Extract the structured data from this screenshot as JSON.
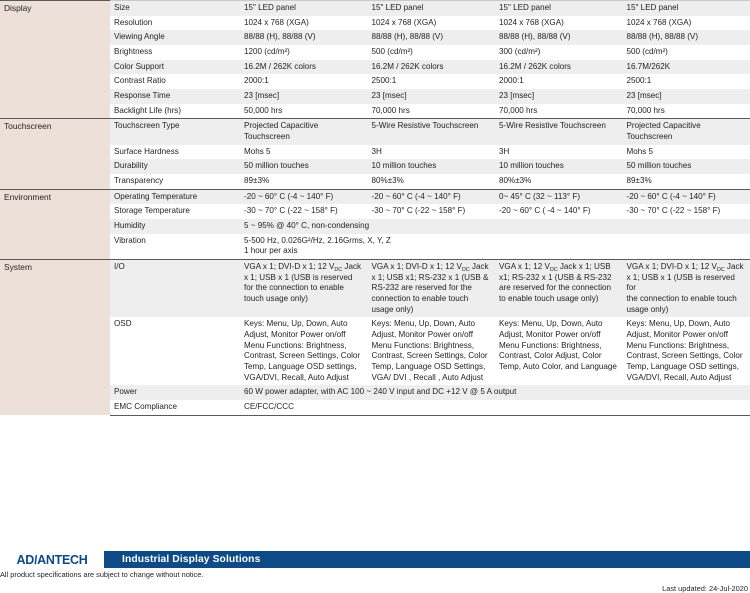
{
  "document": {
    "type": "product-specification-table",
    "columns_count": 4
  },
  "sections": [
    {
      "group": "Display",
      "rows": [
        {
          "name": "Size",
          "values": [
            "15\" LED panel",
            "15\" LED panel",
            "15\" LED panel",
            "15\" LED panel"
          ]
        },
        {
          "name": "Resolution",
          "values": [
            "1024 x 768 (XGA)",
            "1024 x 768 (XGA)",
            "1024 x 768 (XGA)",
            "1024 x 768 (XGA)"
          ]
        },
        {
          "name": "Viewing Angle",
          "values": [
            "88/88 (H), 88/88 (V)",
            "88/88 (H), 88/88 (V)",
            "88/88 (H), 88/88 (V)",
            "88/88 (H), 88/88 (V)"
          ]
        },
        {
          "name": "Brightness",
          "values": [
            "1200 (cd/m²)",
            "500 (cd/m²)",
            "300 (cd/m²)",
            "500 (cd/m²)"
          ]
        },
        {
          "name": "Color Support",
          "values": [
            "16.2M / 262K colors",
            "16.2M / 262K colors",
            "16.2M / 262K colors",
            "16.7M/262K"
          ]
        },
        {
          "name": "Contrast Ratio",
          "values": [
            "2000:1",
            "2500:1",
            "2000:1",
            "2500:1"
          ]
        },
        {
          "name": "Response Time",
          "values": [
            "23 [msec]",
            "23 [msec]",
            "23 [msec]",
            "23 [msec]"
          ]
        },
        {
          "name": "Backlight Life (hrs)",
          "values": [
            "50,000 hrs",
            "70,000 hrs",
            "70,000 hrs",
            "70,000 hrs"
          ]
        }
      ]
    },
    {
      "group": "Touchscreen",
      "rows": [
        {
          "name": "Touchscreen Type",
          "values": [
            "Projected Capacitive Touchscreen",
            "5-Wire Resistive Touchscreen",
            "5-Wire Resistive Touchscreen",
            "Projected Capacitive Touchscreen"
          ]
        },
        {
          "name": "Surface Hardness",
          "values": [
            "Mohs 5",
            "3H",
            "3H",
            "Mohs 5"
          ]
        },
        {
          "name": "Durability",
          "values": [
            "50 million touches",
            "10 million  touches",
            "10 million touches",
            "50 million touches"
          ]
        },
        {
          "name": "Transparency",
          "values": [
            "89±3%",
            "80%±3%",
            "80%±3%",
            "89±3%"
          ]
        }
      ]
    },
    {
      "group": "Environment",
      "rows": [
        {
          "name": "Operating Temperature",
          "values": [
            "-20 ~ 60° C (-4 ~ 140° F)",
            "-20 ~ 60° C (-4 ~ 140° F)",
            "0~ 45° C (32 ~ 113° F)",
            "-20 ~ 60° C (-4 ~ 140° F)"
          ]
        },
        {
          "name": "Storage Temperature",
          "values": [
            "-30 ~ 70° C (-22 ~ 158° F)",
            "-30 ~ 70° C (-22 ~ 158° F)",
            "-20 ~ 60° C ( -4 ~ 140° F)",
            "-30 ~ 70° C (-22 ~ 158° F)"
          ]
        },
        {
          "name": "Humidity",
          "span": true,
          "values": [
            "5 ~ 95% @ 40° C, non-condensing"
          ]
        },
        {
          "name": "Vibration",
          "span": true,
          "values": [
            "5-500 Hz, 0.026G²/Hz, 2.16Grms, X, Y, Z\n1 hour per axis"
          ]
        }
      ]
    },
    {
      "group": "System",
      "rows": [
        {
          "name": "I/O",
          "values": [
            "VGA x 1; DVI-D x 1; 12 V|DC| Jack x 1; USB x 1 (USB is reserved for the connection to enable touch usage only)",
            "VGA x 1; DVI-D x 1; 12 V|DC| Jack x 1; USB x1; RS-232 x 1 (USB & RS-232 are reserved for the connection to enable touch usage only)",
            "VGA x 1; 12 V|DC|  Jack x 1; USB x1; RS-232 x 1 (USB & RS-232 are reserved for the connection to enable touch usage only)",
            "VGA x 1; DVI-D x 1; 12 V|DC| Jack x 1; USB x 1 (USB is reserved for\nthe connection to enable touch usage only)"
          ]
        },
        {
          "name": "OSD",
          "values": [
            "Keys: Menu, Up, Down, Auto Adjust, Monitor Power on/off\nMenu Functions: Brightness, Contrast, Screen Settings, Color Temp, Language OSD settings, VGA/DVI, Recall, Auto Adjust",
            "Keys: Menu, Up, Down, Auto Adjust, Monitor Power on/off\nMenu Functions: Brightness, Contrast, Screen Settings, Color Temp, Language  OSD Settings,\nVGA/ DVI , Recall , Auto Adjust",
            "Keys: Menu, Up, Down, Auto Adjust, Monitor Power on/off\nMenu Functions: Brightness, Contrast, Color Adjust, Color Temp, Auto Color, and Language",
            "Keys: Menu, Up, Down, Auto Adjust, Monitor Power on/off\nMenu Functions: Brightness, Contrast, Screen Settings, Color Temp, Language OSD settings, VGA/DVI, Recall, Auto Adjust"
          ]
        },
        {
          "name": "Power",
          "span": true,
          "values": [
            "60 W power adapter, with AC 100 ~ 240 V input and DC +12 V @ 5 A output"
          ]
        },
        {
          "name": "EMC Compliance",
          "span": true,
          "values": [
            "CE/FCC/CCC"
          ]
        }
      ]
    }
  ],
  "footer": {
    "logo_before": "AD",
    "logo_slash": "\\",
    "logo_after": "ANTECH",
    "bar_title": "Industrial Display Solutions",
    "disclaimer": "All product specifications are subject to change without notice.",
    "last_updated": "Last updated: 24-Jul-2020",
    "bar_color": "#0d4a86"
  }
}
